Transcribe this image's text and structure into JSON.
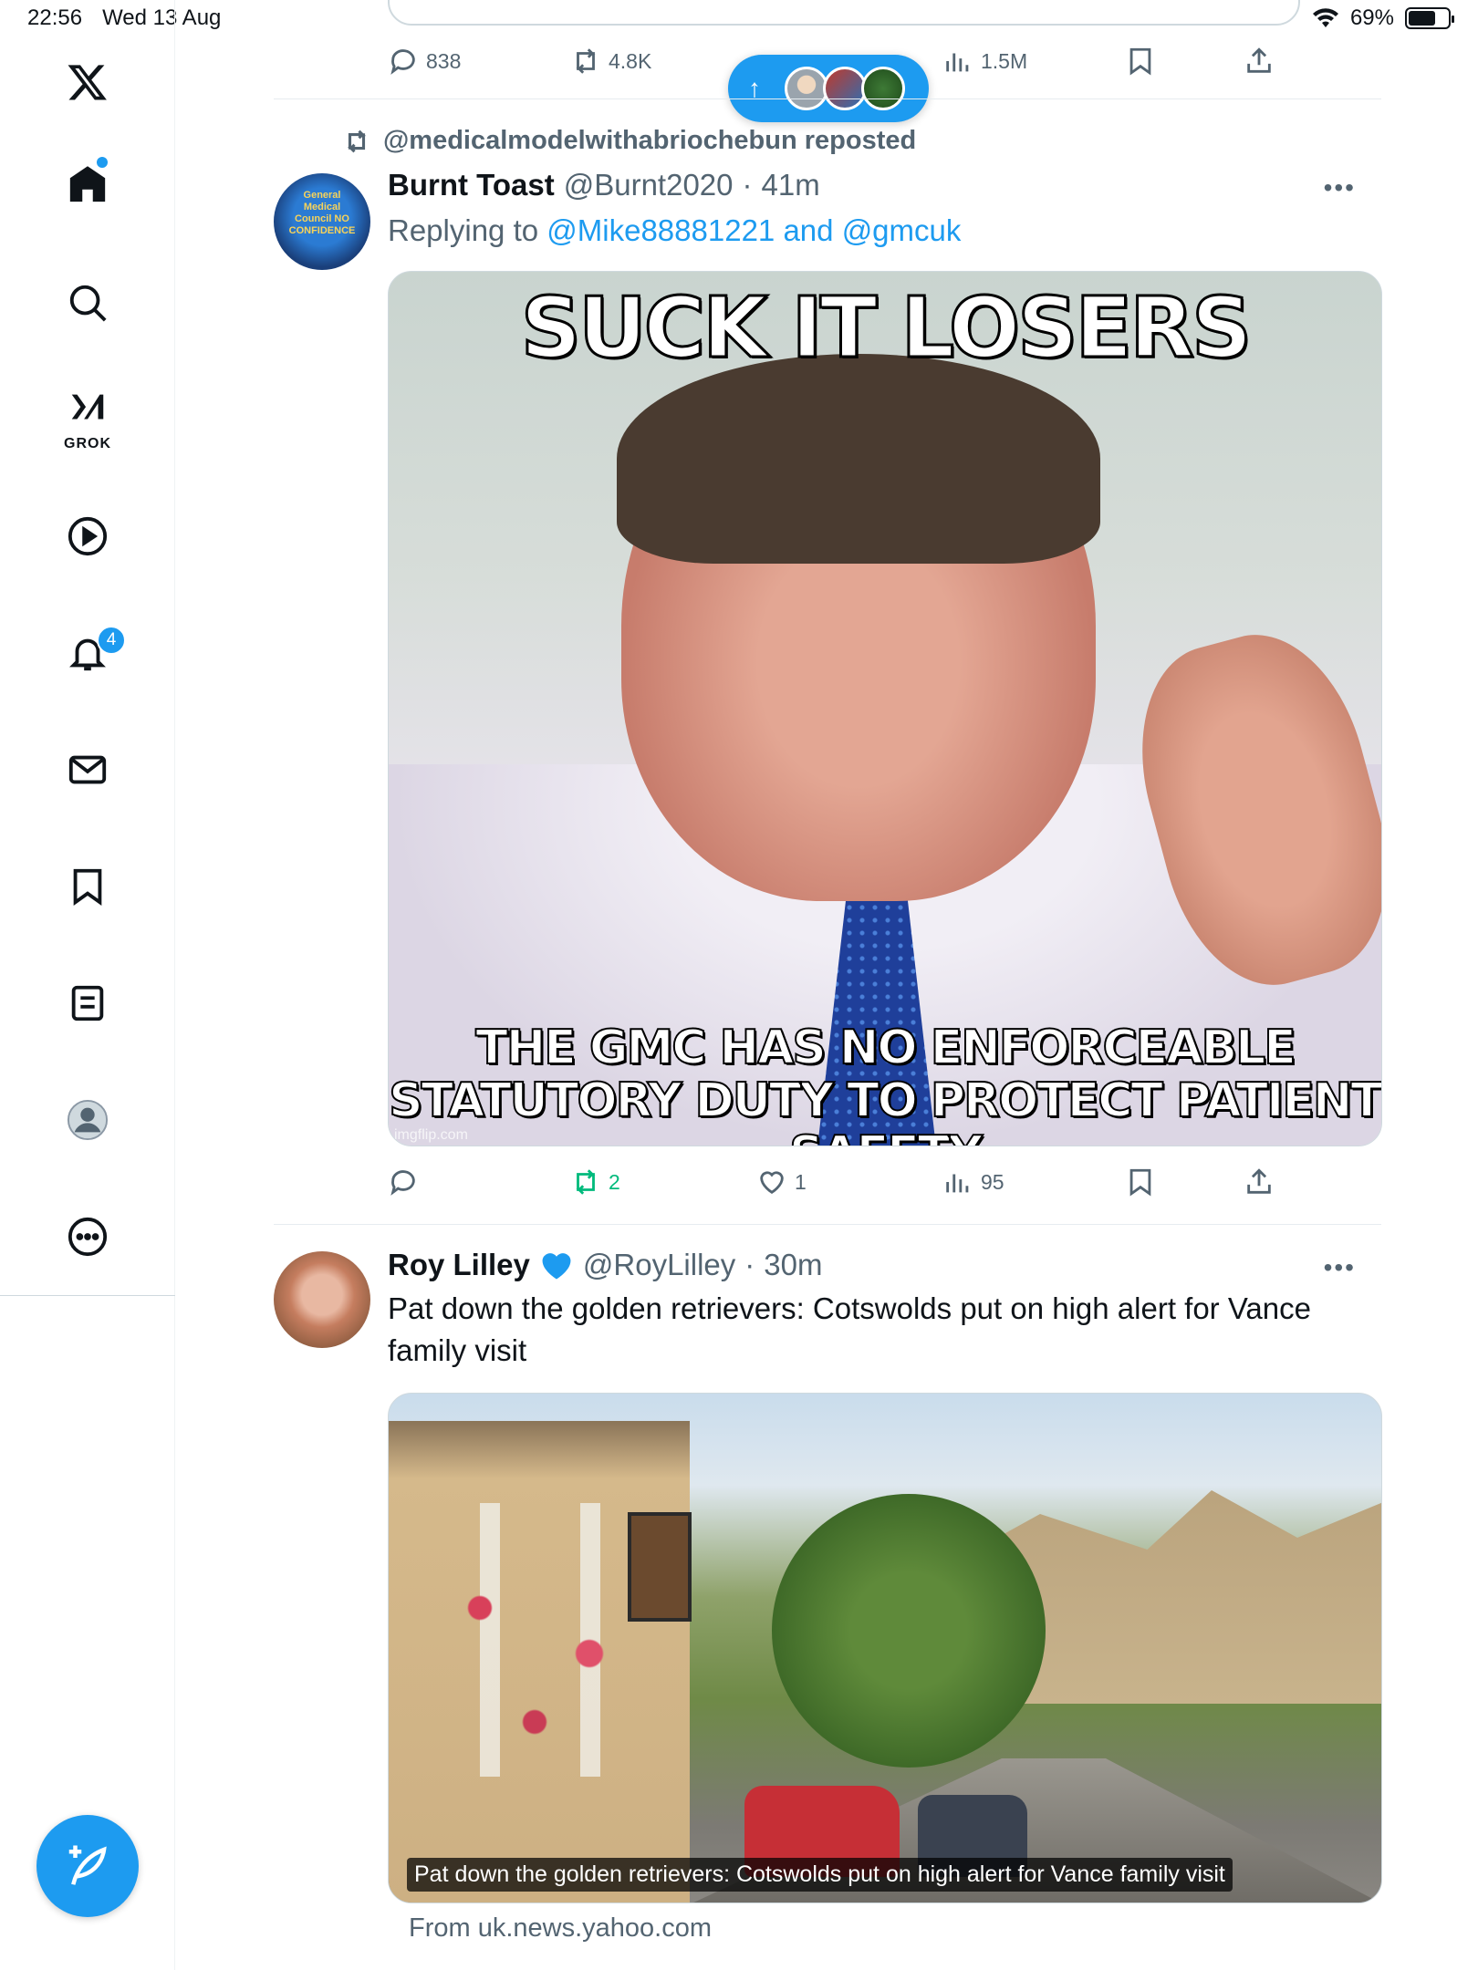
{
  "status_bar": {
    "time": "22:56",
    "date": "Wed 13 Aug",
    "battery": "69%",
    "battery_level": 0.69
  },
  "sidebar": {
    "grok_label": "GROK",
    "notifications_badge": "4",
    "items": [
      "home",
      "search",
      "grok",
      "videos",
      "notifications",
      "messages",
      "bookmarks",
      "lists",
      "profile",
      "more"
    ]
  },
  "previous_tweet": {
    "stats": {
      "replies": "838",
      "reposts": "4.8K",
      "views": "1.5M"
    }
  },
  "new_posts_pill": {
    "label": "↑"
  },
  "tweets": [
    {
      "repost_label": "@medicalmodelwithabriochebun reposted",
      "display_name": "Burnt Toast",
      "handle": "@Burnt2020",
      "separator": "·",
      "time": "41m",
      "replying_prefix": "Replying to",
      "replying_user1": "@Mike88881221",
      "replying_and": "and",
      "replying_user2": "@gmcuk",
      "avatar_text": "General Medical Council NO CONFIDENCE",
      "meme_top": "SUCK IT LOSERS",
      "meme_bottom_1": "THE GMC HAS NO ENFORCEABLE",
      "meme_bottom_2": "STATUTORY DUTY TO PROTECT PATIENT SAFETY",
      "watermark": "imgflip.com",
      "stats": {
        "replies": "",
        "reposts": "2",
        "likes": "1",
        "views": "95"
      }
    },
    {
      "display_name": "Roy Lilley",
      "verified_icon": "blue-heart-icon",
      "handle": "@RoyLilley",
      "separator": "·",
      "time": "30m",
      "text": "Pat down the golden retrievers: Cotswolds put on high alert for Vance family visit",
      "media_caption": "Pat down the golden retrievers: Cotswolds put on high alert for Vance family visit",
      "source": "From uk.news.yahoo.com"
    }
  ],
  "colors": {
    "accent": "#1d9bf0",
    "repost_green": "#00ba7c",
    "secondary_text": "#536471"
  }
}
